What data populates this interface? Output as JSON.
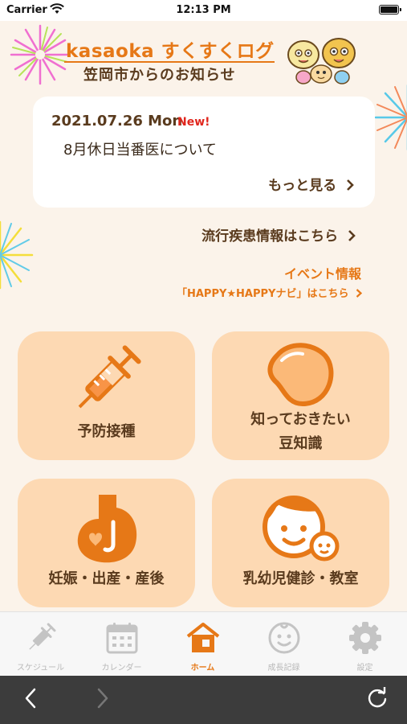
{
  "status_bar": {
    "carrier": "Carrier",
    "time": "12:13 PM"
  },
  "header": {
    "title": "kasaoka すくすくログ",
    "subtitle": "笠岡市からのお知らせ"
  },
  "news": {
    "date": "2021.07.26 Mon",
    "badge": "New!",
    "title": "8月休日当番医について",
    "more": "もっと見る"
  },
  "links": {
    "disease": "流行疾患情報はこちら",
    "event_title": "イベント情報",
    "event_sub": "「HAPPY★HAPPYナビ」はこちら"
  },
  "tiles": [
    {
      "label": "予防接種",
      "icon": "syringe-icon"
    },
    {
      "label": "知っておきたい",
      "label2": "豆知識",
      "icon": "bean-icon"
    },
    {
      "label": "妊娠・出産・産後",
      "icon": "pregnancy-icon"
    },
    {
      "label": "乳幼児健診・教室",
      "icon": "parent-child-icon"
    }
  ],
  "tabs": [
    {
      "label": "スケジュール",
      "icon": "syringe-icon"
    },
    {
      "label": "カレンダー",
      "icon": "calendar-icon"
    },
    {
      "label": "ホーム",
      "icon": "home-icon",
      "active": true
    },
    {
      "label": "成長記録",
      "icon": "baby-face-icon"
    },
    {
      "label": "設定",
      "icon": "gear-icon"
    }
  ],
  "colors": {
    "accent": "#e67817",
    "tile_bg": "#fdd9b3",
    "page_bg": "#fbf3ea",
    "text_brown": "#5a3b1e",
    "new_red": "#e0261d"
  }
}
